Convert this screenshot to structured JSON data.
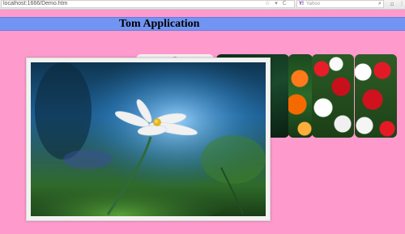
{
  "browser": {
    "url": "localhost:1666/Demo.htm",
    "url_icons": "☆ ▾ C",
    "search_engine_label": "Yahoo",
    "search_engine_mark": "Y!",
    "search_go": "⌕",
    "home": "⌂",
    "menu_grip": "⋮"
  },
  "page": {
    "title": "Tom Application"
  },
  "gallery": {
    "items": [
      {
        "name": "top-rose-strip",
        "colors": [
          "#d91a1a",
          "#f2f2f2"
        ]
      },
      {
        "name": "dark-green",
        "colors": [
          "#0d2f1c",
          "#1a4a2c"
        ]
      },
      {
        "name": "orange-flowers",
        "colors": [
          "#ff7a1a",
          "#2a6a2a"
        ]
      },
      {
        "name": "red-white-roses-1",
        "colors": [
          "#e71d2a",
          "#ffffff"
        ]
      },
      {
        "name": "red-white-roses-2",
        "colors": [
          "#e21a28",
          "#ffffff"
        ]
      }
    ],
    "featured": {
      "name": "white-flower-blue-bokeh",
      "colors": [
        "#1e6fb3",
        "#2f7a2c",
        "#f1f1f1"
      ]
    }
  },
  "colors": {
    "page_background": "#ff9acd",
    "header_background": "#7294f2",
    "header_text": "#000000"
  }
}
